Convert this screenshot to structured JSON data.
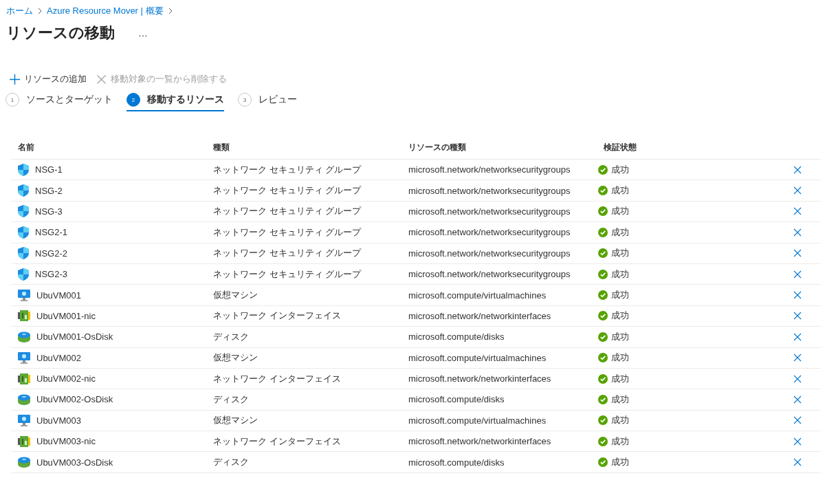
{
  "breadcrumb": [
    {
      "label": "ホーム"
    },
    {
      "label": "Azure Resource Mover | 概要"
    }
  ],
  "title": "リソースの移動",
  "more": "…",
  "toolbar": [
    {
      "kind": "add",
      "label": "リソースの追加",
      "disabled": false
    },
    {
      "kind": "remove",
      "label": "移動対象の一覧から削除する",
      "disabled": true
    }
  ],
  "steps": [
    {
      "number": "1",
      "label": "ソースとターゲット",
      "selected": false
    },
    {
      "number": "2",
      "label": "移動するリソース",
      "selected": true
    },
    {
      "number": "3",
      "label": "レビュー",
      "selected": false
    }
  ],
  "table": {
    "columns": [
      "名前",
      "種類",
      "リソースの種類",
      "検証状態"
    ],
    "rows": [
      {
        "kind": "nsg",
        "name": "NSG-1",
        "type": "ネットワーク セキュリティ グループ",
        "resource_type": "microsoft.network/networksecuritygroups",
        "status": "成功",
        "succeeded": true
      },
      {
        "kind": "nsg",
        "name": "NSG-2",
        "type": "ネットワーク セキュリティ グループ",
        "resource_type": "microsoft.network/networksecuritygroups",
        "status": "成功",
        "succeeded": true
      },
      {
        "kind": "nsg",
        "name": "NSG-3",
        "type": "ネットワーク セキュリティ グループ",
        "resource_type": "microsoft.network/networksecuritygroups",
        "status": "成功",
        "succeeded": true
      },
      {
        "kind": "nsg",
        "name": "NSG2-1",
        "type": "ネットワーク セキュリティ グループ",
        "resource_type": "microsoft.network/networksecuritygroups",
        "status": "成功",
        "succeeded": true
      },
      {
        "kind": "nsg",
        "name": "NSG2-2",
        "type": "ネットワーク セキュリティ グループ",
        "resource_type": "microsoft.network/networksecuritygroups",
        "status": "成功",
        "succeeded": true
      },
      {
        "kind": "nsg",
        "name": "NSG2-3",
        "type": "ネットワーク セキュリティ グループ",
        "resource_type": "microsoft.network/networksecuritygroups",
        "status": "成功",
        "succeeded": true
      },
      {
        "kind": "vm",
        "name": "UbuVM001",
        "type": "仮想マシン",
        "resource_type": "microsoft.compute/virtualmachines",
        "status": "成功",
        "succeeded": true
      },
      {
        "kind": "nic",
        "name": "UbuVM001-nic",
        "type": "ネットワーク インターフェイス",
        "resource_type": "microsoft.network/networkinterfaces",
        "status": "成功",
        "succeeded": true
      },
      {
        "kind": "disk",
        "name": "UbuVM001-OsDisk",
        "type": "ディスク",
        "resource_type": "microsoft.compute/disks",
        "status": "成功",
        "succeeded": true
      },
      {
        "kind": "vm",
        "name": "UbuVM002",
        "type": "仮想マシン",
        "resource_type": "microsoft.compute/virtualmachines",
        "status": "成功",
        "succeeded": true
      },
      {
        "kind": "nic",
        "name": "UbuVM002-nic",
        "type": "ネットワーク インターフェイス",
        "resource_type": "microsoft.network/networkinterfaces",
        "status": "成功",
        "succeeded": true
      },
      {
        "kind": "disk",
        "name": "UbuVM002-OsDisk",
        "type": "ディスク",
        "resource_type": "microsoft.compute/disks",
        "status": "成功",
        "succeeded": true
      },
      {
        "kind": "vm",
        "name": "UbuVM003",
        "type": "仮想マシン",
        "resource_type": "microsoft.compute/virtualmachines",
        "status": "成功",
        "succeeded": true
      },
      {
        "kind": "nic",
        "name": "UbuVM003-nic",
        "type": "ネットワーク インターフェイス",
        "resource_type": "microsoft.network/networkinterfaces",
        "status": "成功",
        "succeeded": true
      },
      {
        "kind": "disk",
        "name": "UbuVM003-OsDisk",
        "type": "ディスク",
        "resource_type": "microsoft.compute/disks",
        "status": "成功",
        "succeeded": true
      }
    ]
  }
}
